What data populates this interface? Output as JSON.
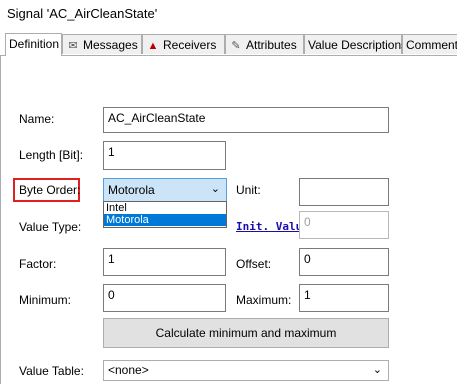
{
  "window": {
    "title": "Signal 'AC_AirCleanState'"
  },
  "tabs": [
    {
      "label": "Definition",
      "icon": "",
      "active": true
    },
    {
      "label": "Messages",
      "icon": "envelope-icon"
    },
    {
      "label": "Receivers",
      "icon": "receiver-icon"
    },
    {
      "label": "Attributes",
      "icon": "pencil-icon"
    },
    {
      "label": "Value Descriptions",
      "icon": ""
    },
    {
      "label": "Comment",
      "icon": ""
    }
  ],
  "form": {
    "name_label": "Name:",
    "name_value": "AC_AirCleanState",
    "length_label": "Length [Bit]:",
    "length_value": "1",
    "byte_order_label": "Byte Order:",
    "byte_order_value": "Motorola",
    "byte_order_options": [
      "Intel",
      "Motorola"
    ],
    "unit_label": "Unit:",
    "unit_value": "",
    "value_type_label": "Value Type:",
    "init_value_label": "Init. Value",
    "init_value": "0",
    "factor_label": "Factor:",
    "factor_value": "1",
    "offset_label": "Offset:",
    "offset_value": "0",
    "minimum_label": "Minimum:",
    "minimum_value": "0",
    "maximum_label": "Maximum:",
    "maximum_value": "1",
    "calc_button": "Calculate minimum and maximum",
    "value_table_label": "Value Table:",
    "value_table_value": "<none>"
  },
  "colors": {
    "highlight": "#e02020",
    "selection": "#0078d7",
    "combo_focus": "#cce4f7"
  }
}
